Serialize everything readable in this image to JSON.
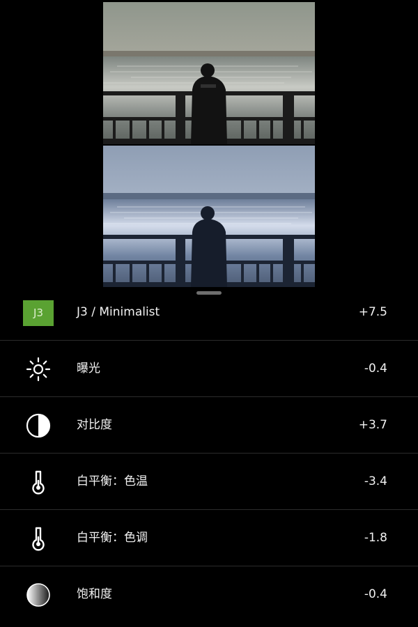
{
  "preset": {
    "badge": "J3",
    "label": "J3 / Minimalist",
    "value": "+7.5"
  },
  "adjustments": [
    {
      "icon": "sun-icon",
      "label": "曝光",
      "value": "-0.4"
    },
    {
      "icon": "contrast-icon",
      "label": "对比度",
      "value": "+3.7"
    },
    {
      "icon": "thermometer-icon",
      "label": "白平衡：色温",
      "value": "-3.4"
    },
    {
      "icon": "thermometer-icon",
      "label": "白平衡：色调",
      "value": "-1.8"
    },
    {
      "icon": "saturation-icon",
      "label": "饱和度",
      "value": "-0.4"
    }
  ]
}
